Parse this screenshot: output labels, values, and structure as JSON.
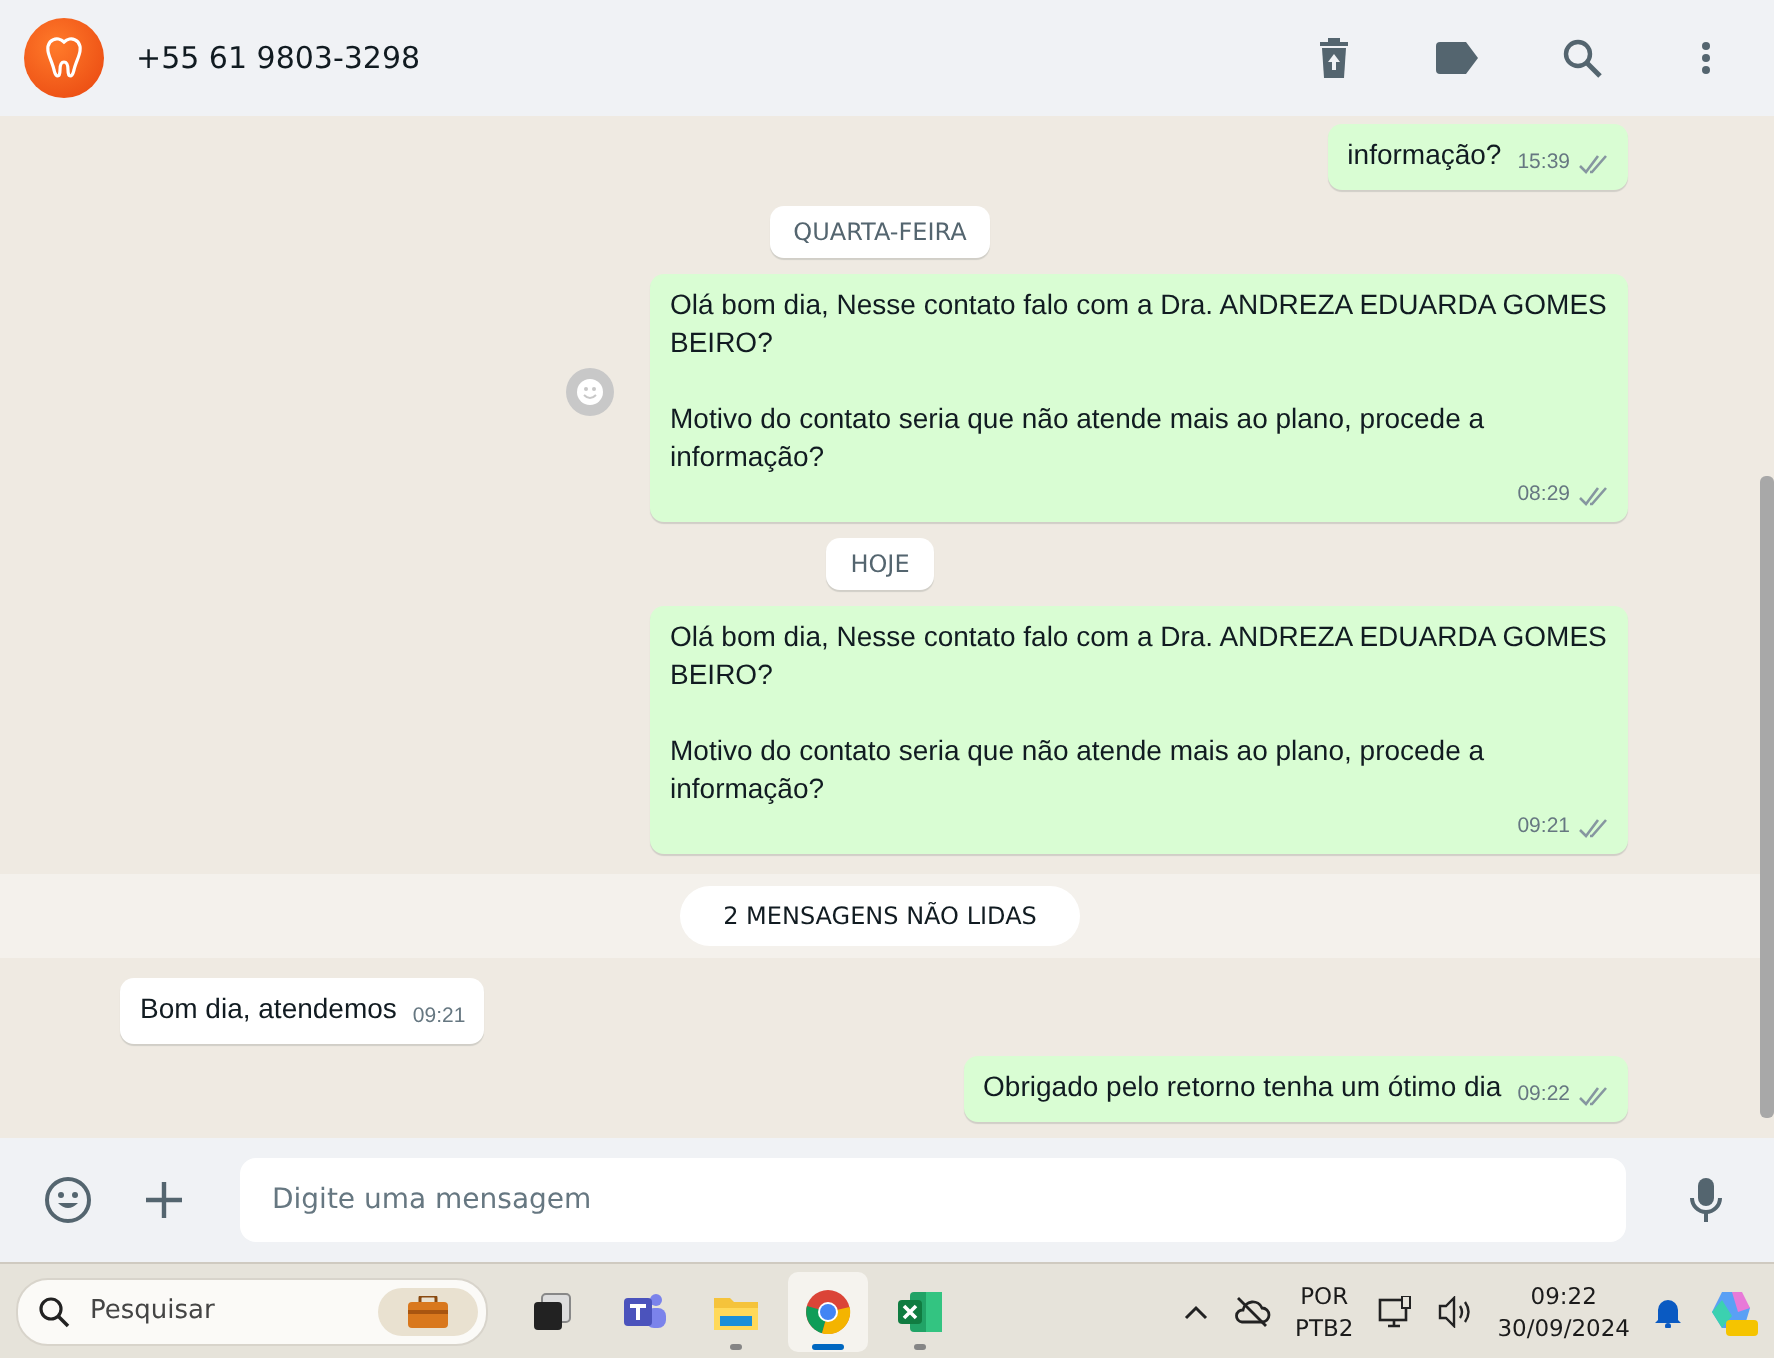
{
  "header": {
    "contact": "+55 61 9803-3298"
  },
  "messages": [
    {
      "kind": "out",
      "text": "informação?",
      "time": "15:39",
      "read": true,
      "react_button": false
    },
    {
      "kind": "date",
      "text": "QUARTA-FEIRA"
    },
    {
      "kind": "out",
      "text": "Olá bom dia, Nesse contato falo com a Dra. ANDREZA EDUARDA GOMES BEIRO?\n\nMotivo do contato seria que não atende mais ao plano, procede a informação?",
      "time": "08:29",
      "read": true,
      "react_button": true
    },
    {
      "kind": "date",
      "text": "HOJE"
    },
    {
      "kind": "out",
      "text": "Olá bom dia, Nesse contato falo com a Dra. ANDREZA EDUARDA GOMES BEIRO?\n\nMotivo do contato seria que não atende mais ao plano, procede a informação?",
      "time": "09:21",
      "read": true,
      "react_button": false
    },
    {
      "kind": "unread",
      "text": "2 MENSAGENS NÃO LIDAS"
    },
    {
      "kind": "in",
      "text": "Bom dia, atendemos",
      "time": "09:21"
    },
    {
      "kind": "out",
      "text": "Obrigado pelo retorno tenha um ótimo dia",
      "time": "09:22",
      "read": true,
      "react_button": false
    }
  ],
  "composer": {
    "placeholder": "Digite uma mensagem"
  },
  "taskbar": {
    "search_placeholder": "Pesquisar",
    "apps": [
      {
        "kind": "taskview",
        "selected": false,
        "running": false
      },
      {
        "kind": "teams",
        "selected": false,
        "running": false
      },
      {
        "kind": "files",
        "selected": false,
        "running": true
      },
      {
        "kind": "chrome",
        "selected": true,
        "running": true
      },
      {
        "kind": "excel",
        "selected": false,
        "running": true
      }
    ],
    "language": "POR",
    "layout": "PTB2",
    "time": "09:22",
    "date": "30/09/2024"
  }
}
